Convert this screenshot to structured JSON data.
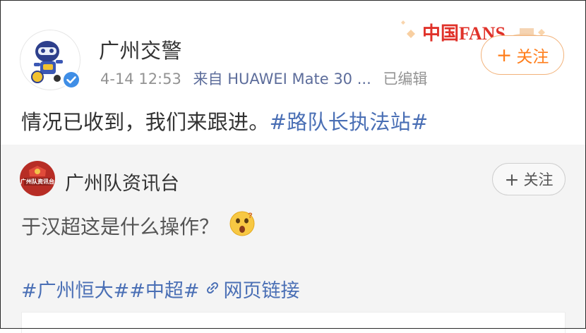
{
  "post": {
    "author": "广州交警",
    "time": "4-14 12:53",
    "source": "来自 HUAWEI Mate 30 ...",
    "edited": "已编辑",
    "follow_label": "关注",
    "text": "情况已收到，我们来跟进。",
    "topic": "#路队长执法站#",
    "badge_text": "中国FANS"
  },
  "repost": {
    "author": "广州队资讯台",
    "avatar_text": "广州队资讯台",
    "follow_label": "关注",
    "text": "于汉超这是什么操作？",
    "tag1": "#广州恒大#",
    "tag2": "#中超#",
    "link_label": "网页链接"
  },
  "colors": {
    "accent_orange": "#ff7d1a",
    "link_blue": "#4a6fb5",
    "verified_blue": "#3f8ee6",
    "repost_bg": "#f4f4f4"
  },
  "icons": {
    "verified": "verified-badge-icon",
    "plus": "plus-icon",
    "emoji": "surprised-emoji-icon",
    "link": "link-icon"
  }
}
